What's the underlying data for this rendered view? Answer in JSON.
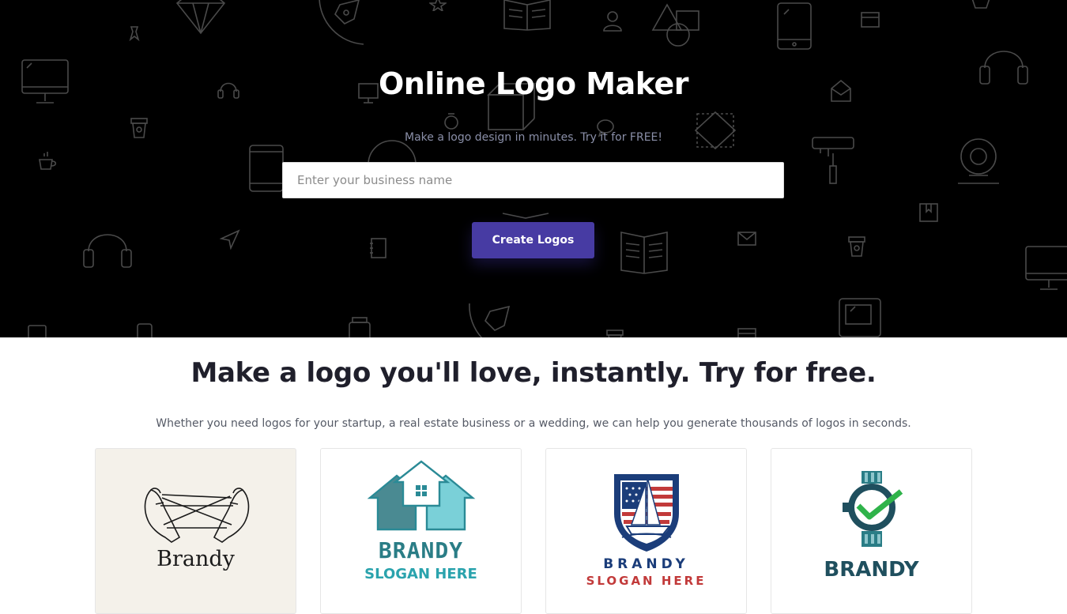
{
  "hero": {
    "title": "Online Logo Maker",
    "subtitle": "Make a logo design in minutes. Try it for FREE!",
    "search_placeholder": "Enter your business name",
    "create_button": "Create Logos"
  },
  "section": {
    "title": "Make a logo you'll love, instantly. Try for free.",
    "subtitle": "Whether you need logos for your startup, a real estate business or a wedding, we can help you generate thousands of logos in seconds."
  },
  "cards": [
    {
      "name": "Brandy",
      "slogan": ""
    },
    {
      "name": "BRANDY",
      "slogan": "SLOGAN HERE"
    },
    {
      "name": "BRANDY",
      "slogan": "SLOGAN HERE"
    },
    {
      "name": "BRANDY",
      "slogan": ""
    }
  ],
  "colors": {
    "hero_bg": "#000000",
    "accent": "#473ba3",
    "teal": "#2a7d86",
    "navy": "#1b3d7a",
    "red": "#c23a3a",
    "dark_teal": "#1f4f5e",
    "green": "#2fb34a"
  }
}
